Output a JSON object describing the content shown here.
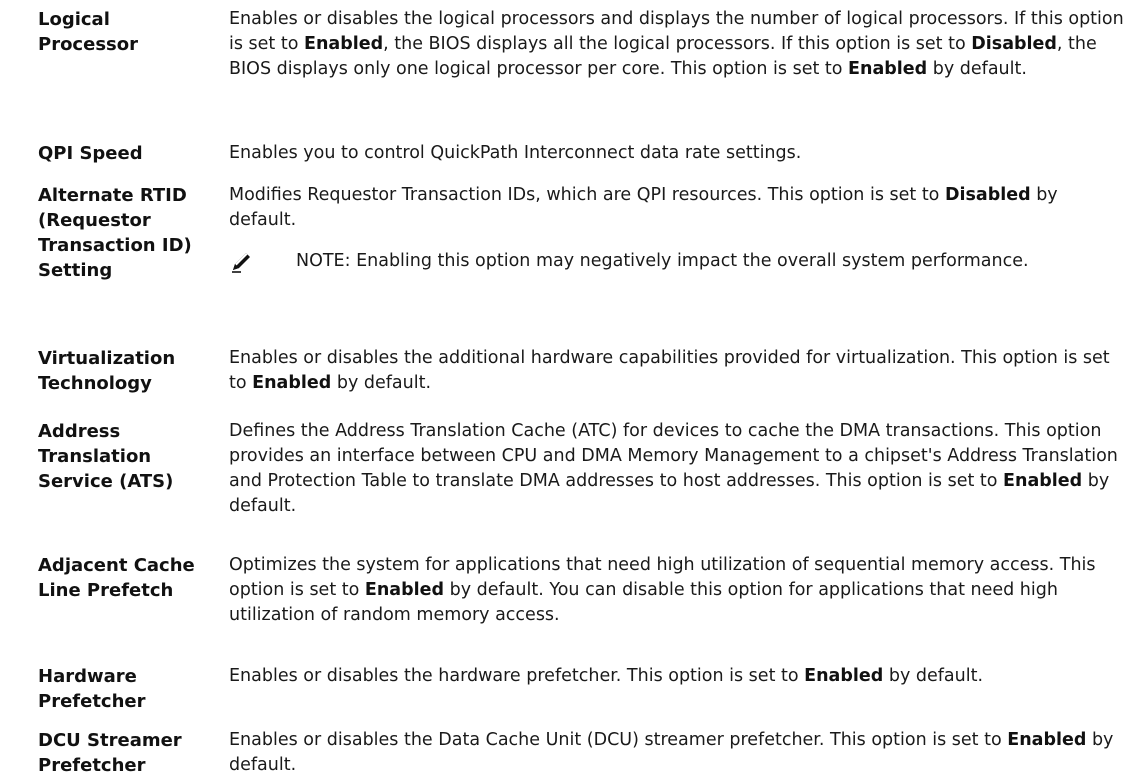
{
  "rows": [
    {
      "term": "Logical Processor",
      "desc": [
        {
          "t": "Enables or disables the logical processors and displays the number of logical processors. If this option is set to "
        },
        {
          "t": "Enabled",
          "b": true
        },
        {
          "t": ", the BIOS displays all the logical processors. If this option is set to "
        },
        {
          "t": "Disabled",
          "b": true
        },
        {
          "t": ", the BIOS displays only one logical processor per core. This option is set to "
        },
        {
          "t": "Enabled",
          "b": true
        },
        {
          "t": " by default."
        }
      ]
    },
    {
      "term": "QPI Speed",
      "desc": [
        {
          "t": "Enables you to control QuickPath Interconnect data rate settings."
        }
      ]
    },
    {
      "term": "Alternate RTID (Requestor Transaction ID) Setting",
      "desc": [
        {
          "t": "Modifies Requestor Transaction IDs, which are QPI resources. This option is set to "
        },
        {
          "t": "Disabled",
          "b": true
        },
        {
          "t": " by default."
        }
      ],
      "note": {
        "label": "NOTE:",
        "text": " Enabling this option may negatively impact the overall system performance."
      }
    },
    {
      "term": "Virtualization Technology",
      "desc": [
        {
          "t": "Enables or disables the additional hardware capabilities provided for virtualization. This option is set to "
        },
        {
          "t": "Enabled",
          "b": true
        },
        {
          "t": " by default."
        }
      ]
    },
    {
      "term": "Address Translation Service (ATS)",
      "desc": [
        {
          "t": "Defines the Address Translation Cache (ATC) for devices to cache the DMA transactions. This option provides an interface between CPU and DMA Memory Management to a chipset's Address Translation and Protection Table to translate DMA addresses to host addresses. This option is set to "
        },
        {
          "t": "Enabled",
          "b": true
        },
        {
          "t": " by default."
        }
      ]
    },
    {
      "term": "Adjacent Cache Line Prefetch",
      "desc": [
        {
          "t": "Optimizes the system for applications that need high utilization of sequential memory access. This option is set to "
        },
        {
          "t": "Enabled",
          "b": true
        },
        {
          "t": " by default. You can disable this option for applications that need high utilization of random memory access."
        }
      ]
    },
    {
      "term": "Hardware Prefetcher",
      "desc": [
        {
          "t": "Enables or disables the hardware prefetcher. This option is set to "
        },
        {
          "t": "Enabled",
          "b": true
        },
        {
          "t": " by default."
        }
      ]
    },
    {
      "term": "DCU Streamer Prefetcher",
      "desc": [
        {
          "t": "Enables or disables the Data Cache Unit (DCU) streamer prefetcher. This option is set to "
        },
        {
          "t": "Enabled",
          "b": true
        },
        {
          "t": " by default."
        }
      ]
    }
  ],
  "icons": {
    "note": "pencil-note-icon"
  }
}
